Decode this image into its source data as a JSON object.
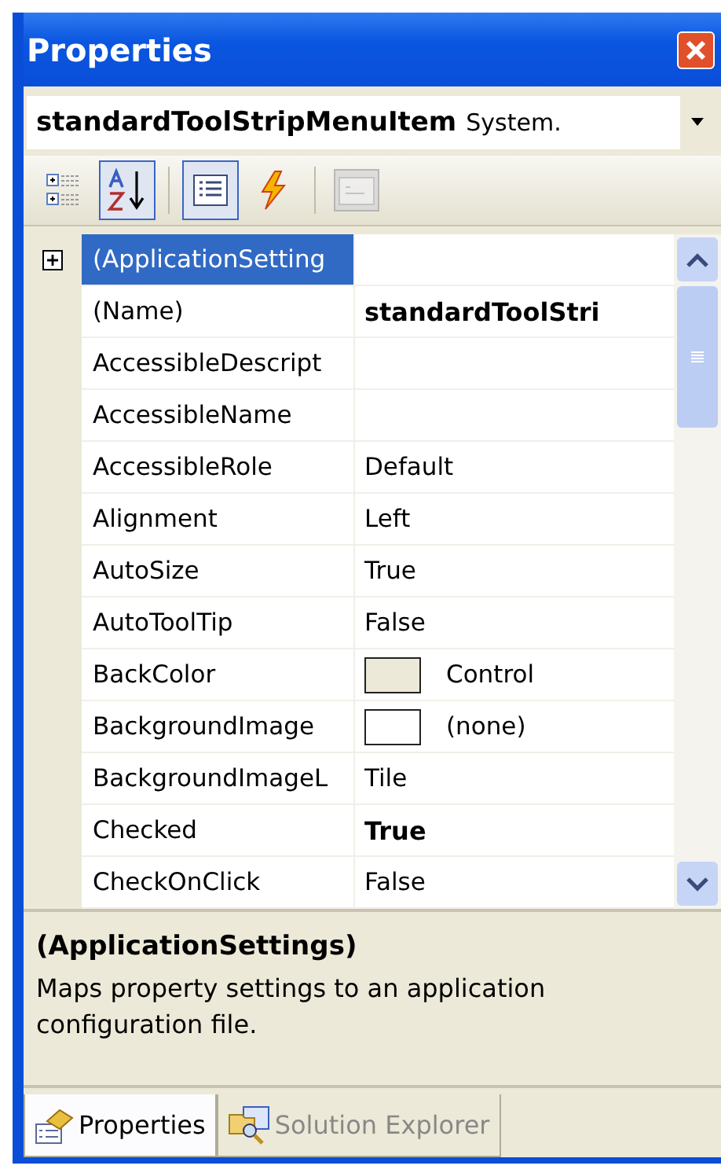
{
  "window": {
    "title": "Properties"
  },
  "object_selector": {
    "name": "standardToolStripMenuItem",
    "type": "System."
  },
  "toolbar": [
    {
      "kind": "categorized",
      "selected": false,
      "disabled": false
    },
    {
      "kind": "alphabetical",
      "selected": true,
      "disabled": false
    },
    {
      "kind": "separator"
    },
    {
      "kind": "properties",
      "selected": true,
      "disabled": false
    },
    {
      "kind": "events",
      "selected": false,
      "disabled": false
    },
    {
      "kind": "separator"
    },
    {
      "kind": "property_pages",
      "selected": false,
      "disabled": true
    }
  ],
  "grid": {
    "rows": [
      {
        "kind": "category",
        "name": "(ApplicationSetting",
        "expanded": false,
        "selected": true
      },
      {
        "kind": "text",
        "name": "(Name)",
        "value": "standardToolStri",
        "modified": true,
        "selected": false
      },
      {
        "kind": "text",
        "name": "AccessibleDescript",
        "selected": false
      },
      {
        "kind": "text",
        "name": "AccessibleName",
        "selected": false
      },
      {
        "kind": "text",
        "name": "AccessibleRole",
        "value": "Default",
        "modified": false,
        "selected": false
      },
      {
        "kind": "text",
        "name": "Alignment",
        "value": "Left",
        "modified": false,
        "selected": false
      },
      {
        "kind": "text",
        "name": "AutoSize",
        "value": "True",
        "modified": false,
        "selected": false
      },
      {
        "kind": "text",
        "name": "AutoToolTip",
        "value": "False",
        "modified": false,
        "selected": false
      },
      {
        "kind": "swatch",
        "name": "BackColor",
        "value": "Control",
        "color": "#ece9d8",
        "modified": false,
        "selected": false
      },
      {
        "kind": "swatch",
        "name": "BackgroundImage",
        "value": "(none)",
        "color": "#ffffff",
        "modified": false,
        "selected": false
      },
      {
        "kind": "text",
        "name": "BackgroundImageL",
        "value": "Tile",
        "modified": false,
        "selected": false
      },
      {
        "kind": "text",
        "name": "Checked",
        "value": "True",
        "modified": true,
        "selected": false
      },
      {
        "kind": "text",
        "name": "CheckOnClick",
        "value": "False",
        "modified": false,
        "selected": false
      }
    ]
  },
  "description": {
    "title": "(ApplicationSettings)",
    "text": "Maps property settings to an application configuration file."
  },
  "tabs": [
    {
      "kind": "properties",
      "label": "Properties",
      "selected": true
    },
    {
      "kind": "solution_explorer",
      "label": "Solution Explorer",
      "selected": false
    }
  ]
}
